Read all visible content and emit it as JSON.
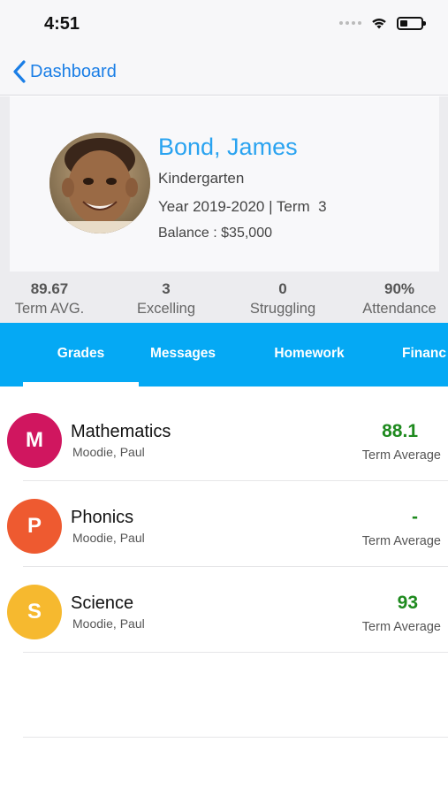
{
  "status_bar": {
    "time": "4:51"
  },
  "nav": {
    "back_label": "Dashboard"
  },
  "profile": {
    "name": "Bond, James",
    "grade_level": "Kindergarten",
    "year_term": "Year 2019-2020 | Term  3",
    "balance": "Balance : $35,000"
  },
  "stats": [
    {
      "value": "89.67",
      "label": "Term AVG."
    },
    {
      "value": "3",
      "label": "Excelling"
    },
    {
      "value": "0",
      "label": "Struggling"
    },
    {
      "value": "90%",
      "label": "Attendance"
    }
  ],
  "tabs": [
    {
      "label": "Grades",
      "selected": true
    },
    {
      "label": "Messages"
    },
    {
      "label": "Homework"
    },
    {
      "label": "Financ"
    }
  ],
  "subjects": [
    {
      "initial": "M",
      "name": "Mathematics",
      "teacher": "Moodie, Paul",
      "average": "88.1",
      "average_label": "Term Average",
      "color": "#d0165f"
    },
    {
      "initial": "P",
      "name": "Phonics",
      "teacher": "Moodie, Paul",
      "average": "-",
      "average_label": "Term Average",
      "color": "#ee5a30"
    },
    {
      "initial": "S",
      "name": "Science",
      "teacher": "Moodie, Paul",
      "average": "93",
      "average_label": "Term Average",
      "color": "#f6b92f"
    }
  ],
  "colors": {
    "accent": "#05a9f4",
    "link": "#1a7ee6",
    "name": "#2aa3f0",
    "average_good": "#1e8a1e"
  }
}
